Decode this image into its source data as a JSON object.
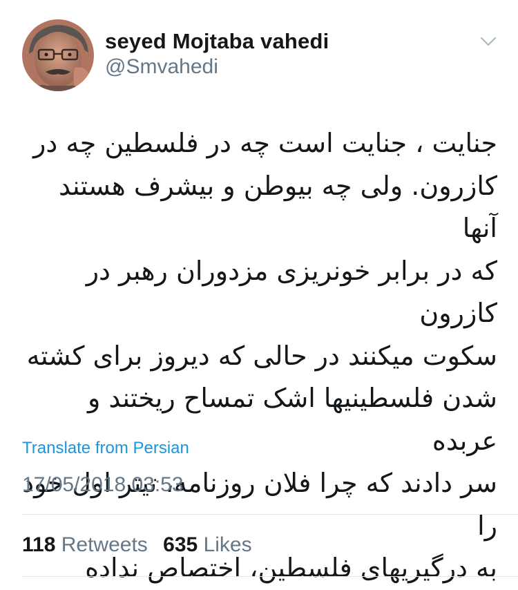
{
  "author": {
    "display_name": "seyed Mojtaba vahedi",
    "handle": "@Smvahedi"
  },
  "tweet": {
    "lines": [
      "جنایت ، جنایت است چه در فلسطین چه در",
      "کازرون. ولی چه بیوطن و بیشرف هستند آنها",
      "که در برابر خونریزی مزدوران رهبر در کازرون",
      "سکوت میکنند در حالی که دیروز  برای کشته",
      "شدن فلسطینیها اشک تمساح ریختند و عربده",
      "سر دادند که چرا فلان روزنامه، تیتر اول خود را",
      "به درگیریهای فلسطین، اختصاص نداده"
    ],
    "translate_label": "Translate from Persian",
    "timestamp": "17/05/2018 03:53"
  },
  "stats": {
    "retweets_count": "118",
    "retweets_label": "Retweets",
    "likes_count": "635",
    "likes_label": "Likes"
  },
  "icons": {
    "menu": "chevron-down-icon"
  },
  "colors": {
    "text": "#14171a",
    "secondary": "#657786",
    "link": "#1b95e0",
    "divider": "#e1e8ed"
  }
}
